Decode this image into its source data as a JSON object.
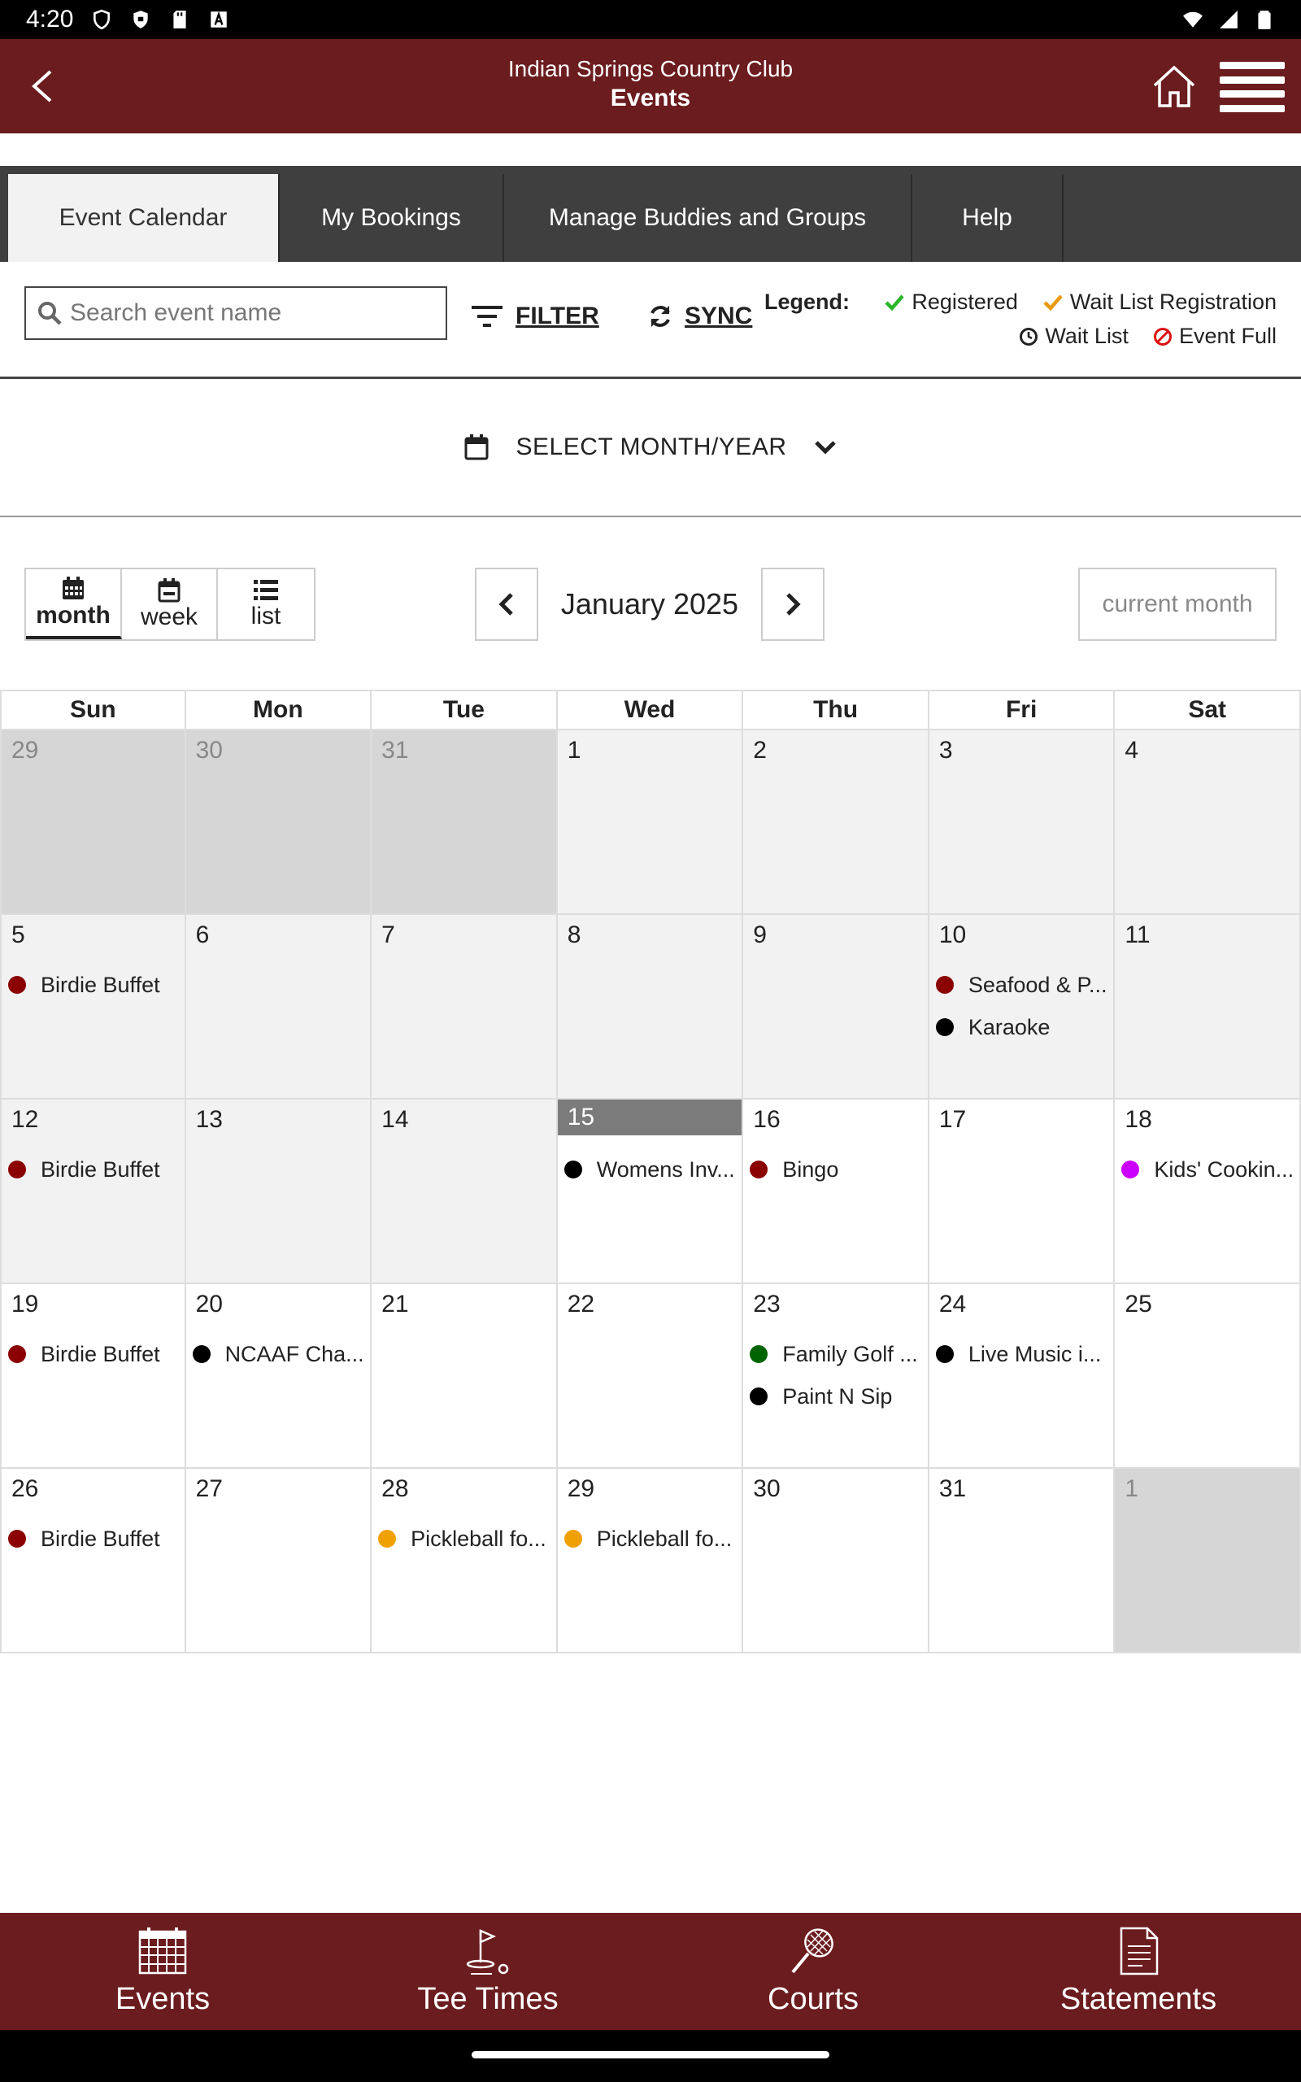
{
  "status_bar": {
    "time": "4:20"
  },
  "header": {
    "club_name": "Indian Springs Country Club",
    "title": "Events"
  },
  "tabs": [
    {
      "label": "Event Calendar",
      "active": true
    },
    {
      "label": "My Bookings"
    },
    {
      "label": "Manage Buddies and Groups"
    },
    {
      "label": "Help"
    }
  ],
  "toolbar": {
    "search_placeholder": "Search event name",
    "filter_label": "FILTER",
    "sync_label": "SYNC"
  },
  "legend": {
    "title": "Legend:",
    "registered": "Registered",
    "wait_list_registration": "Wait List Registration",
    "wait_list": "Wait List",
    "event_full": "Event Full"
  },
  "select_month": {
    "label": "SELECT MONTH/YEAR"
  },
  "views": {
    "month": "month",
    "week": "week",
    "list": "list"
  },
  "calendar": {
    "month_label": "January 2025",
    "current_month_label": "current month",
    "weekdays": [
      "Sun",
      "Mon",
      "Tue",
      "Wed",
      "Thu",
      "Fri",
      "Sat"
    ],
    "days": [
      {
        "num": "29",
        "state": "other"
      },
      {
        "num": "30",
        "state": "other"
      },
      {
        "num": "31",
        "state": "other"
      },
      {
        "num": "1",
        "state": "past"
      },
      {
        "num": "2",
        "state": "past"
      },
      {
        "num": "3",
        "state": "past"
      },
      {
        "num": "4",
        "state": "past"
      },
      {
        "num": "5",
        "state": "past",
        "events": [
          {
            "name": "Birdie Buffet",
            "color": "#8b0000"
          }
        ]
      },
      {
        "num": "6",
        "state": "past"
      },
      {
        "num": "7",
        "state": "past"
      },
      {
        "num": "8",
        "state": "past"
      },
      {
        "num": "9",
        "state": "past"
      },
      {
        "num": "10",
        "state": "past",
        "events": [
          {
            "name": "Seafood & P...",
            "color": "#8b0000"
          },
          {
            "name": "Karaoke",
            "color": "#000000"
          }
        ]
      },
      {
        "num": "11",
        "state": "past"
      },
      {
        "num": "12",
        "state": "past",
        "events": [
          {
            "name": "Birdie Buffet",
            "color": "#8b0000"
          }
        ]
      },
      {
        "num": "13",
        "state": "past"
      },
      {
        "num": "14",
        "state": "past"
      },
      {
        "num": "15",
        "state": "today",
        "events": [
          {
            "name": "Womens Inv...",
            "color": "#000000"
          }
        ]
      },
      {
        "num": "16",
        "state": "future",
        "events": [
          {
            "name": "Bingo",
            "color": "#8b0000"
          }
        ]
      },
      {
        "num": "17",
        "state": "future"
      },
      {
        "num": "18",
        "state": "future",
        "events": [
          {
            "name": "Kids' Cookin...",
            "color": "#cc00ff"
          }
        ]
      },
      {
        "num": "19",
        "state": "future",
        "events": [
          {
            "name": "Birdie Buffet",
            "color": "#8b0000"
          }
        ]
      },
      {
        "num": "20",
        "state": "future",
        "events": [
          {
            "name": "NCAAF Cha...",
            "color": "#000000"
          }
        ]
      },
      {
        "num": "21",
        "state": "future"
      },
      {
        "num": "22",
        "state": "future"
      },
      {
        "num": "23",
        "state": "future",
        "events": [
          {
            "name": "Family Golf ...",
            "color": "#006400"
          },
          {
            "name": "Paint N Sip",
            "color": "#000000"
          }
        ]
      },
      {
        "num": "24",
        "state": "future",
        "events": [
          {
            "name": "Live Music i...",
            "color": "#000000"
          }
        ]
      },
      {
        "num": "25",
        "state": "future"
      },
      {
        "num": "26",
        "state": "future",
        "events": [
          {
            "name": "Birdie Buffet",
            "color": "#8b0000"
          }
        ]
      },
      {
        "num": "27",
        "state": "future"
      },
      {
        "num": "28",
        "state": "future",
        "events": [
          {
            "name": "Pickleball fo...",
            "color": "#f0a000"
          }
        ]
      },
      {
        "num": "29",
        "state": "future",
        "events": [
          {
            "name": "Pickleball fo...",
            "color": "#f0a000"
          }
        ]
      },
      {
        "num": "30",
        "state": "future"
      },
      {
        "num": "31",
        "state": "future"
      },
      {
        "num": "1",
        "state": "other"
      }
    ]
  },
  "bottom_nav": [
    {
      "label": "Events",
      "icon": "calendar-grid-icon"
    },
    {
      "label": "Tee Times",
      "icon": "golf-flag-icon"
    },
    {
      "label": "Courts",
      "icon": "tennis-racket-icon"
    },
    {
      "label": "Statements",
      "icon": "document-icon"
    }
  ],
  "colors": {
    "brand": "#6b1c1e",
    "tab_bar": "#3f3f3f",
    "registered": "#2bb52b",
    "wait_list_registration": "#e89a10",
    "event_full": "#d11"
  }
}
